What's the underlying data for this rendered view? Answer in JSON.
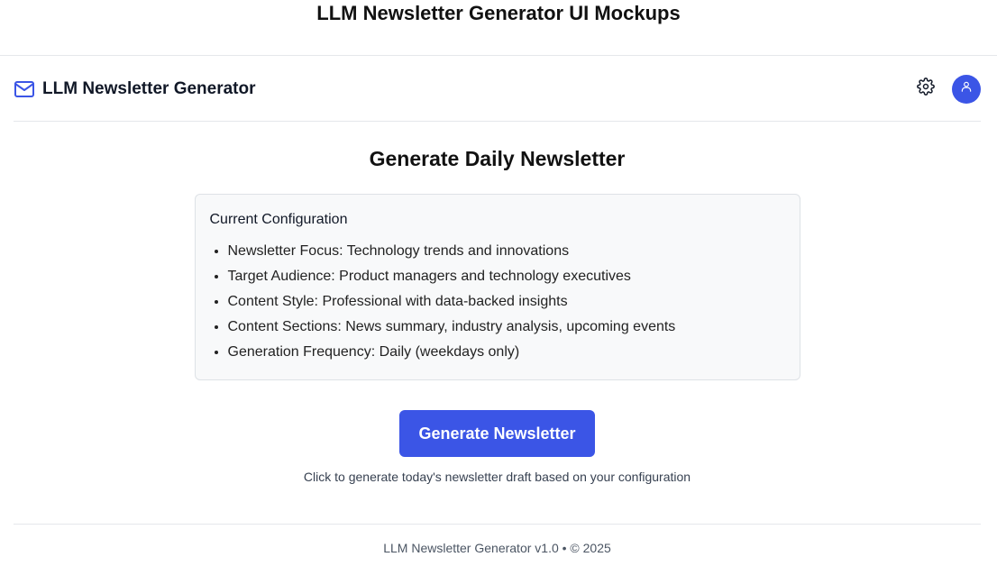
{
  "page": {
    "title": "LLM Newsletter Generator UI Mockups"
  },
  "app": {
    "name": "LLM Newsletter Generator",
    "brand_icon": "mail-icon",
    "accent_color": "#3b55e6",
    "header_actions": {
      "settings_icon": "gear-icon",
      "avatar_icon": "user-icon"
    }
  },
  "main": {
    "heading": "Generate Daily Newsletter",
    "config": {
      "title": "Current Configuration",
      "items": [
        "Newsletter Focus: Technology trends and innovations",
        "Target Audience: Product managers and technology executives",
        "Content Style: Professional with data-backed insights",
        "Content Sections: News summary, industry analysis, upcoming events",
        "Generation Frequency: Daily (weekdays only)"
      ]
    },
    "generate_button_label": "Generate Newsletter",
    "helper_text": "Click to generate today's newsletter draft based on your configuration"
  },
  "footer": {
    "text": "LLM Newsletter Generator v1.0 • © 2025"
  }
}
